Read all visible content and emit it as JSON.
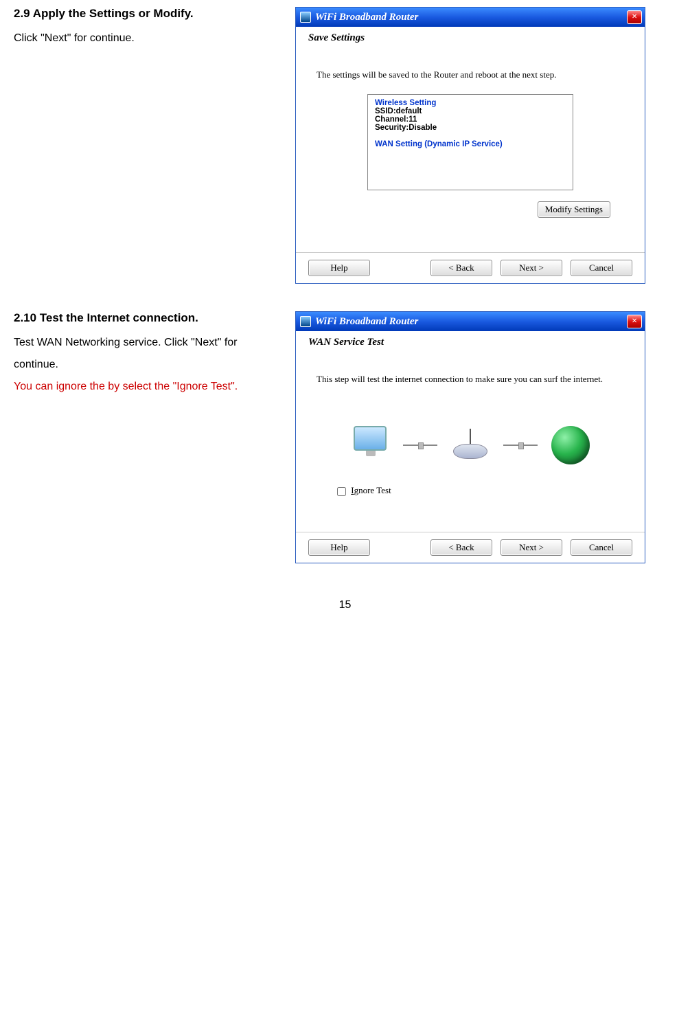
{
  "page_number": "15",
  "section1": {
    "heading": "2.9 Apply the Settings or Modify.",
    "body": "Click \"Next\" for continue.",
    "dialog": {
      "title": "WiFi Broadband Router",
      "section_title": "Save Settings",
      "body_text": "The settings will be saved to the Router and reboot at the next step.",
      "wireless_heading": "Wireless Setting",
      "ssid": "SSID:default",
      "channel": "Channel:11",
      "security": "Security:Disable",
      "wan_heading": "WAN Setting  (Dynamic IP Service)",
      "modify_btn": "Modify Settings",
      "help_btn": "Help",
      "back_btn": "< Back",
      "next_btn": "Next >",
      "cancel_btn": "Cancel"
    }
  },
  "section2": {
    "heading": "2.10 Test the Internet connection.",
    "body1": "Test WAN Networking service. Click \"Next\" for continue.",
    "body2": "You can ignore the by select the \"Ignore Test\".",
    "dialog": {
      "title": "WiFi Broadband Router",
      "section_title": "WAN Service Test",
      "body_text": "This step will test the internet connection to make sure you can surf the internet.",
      "ignore_label": "gnore Test",
      "ignore_key": "I",
      "help_btn": "Help",
      "back_btn": "< Back",
      "next_btn": "Next >",
      "cancel_btn": "Cancel"
    }
  }
}
